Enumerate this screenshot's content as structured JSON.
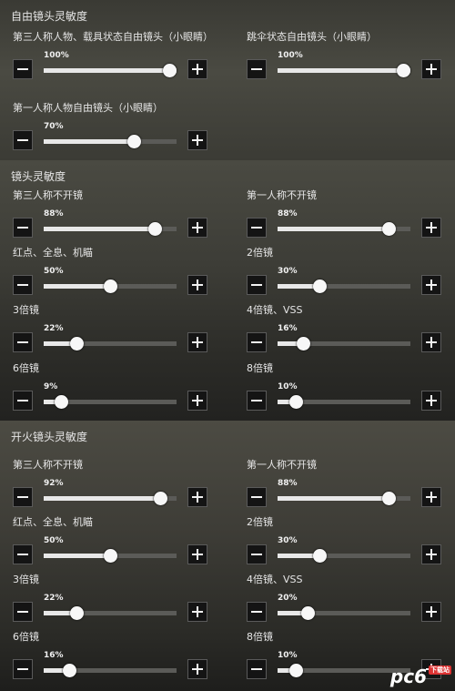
{
  "sections": [
    {
      "title": "自由镜头灵敏度",
      "rows": [
        [
          {
            "label": "第三人称人物、载具状态自由镜头（小眼睛）",
            "value": "100%",
            "level": 1.0
          },
          {
            "label": "跳伞状态自由镜头（小眼睛）",
            "value": "100%",
            "level": 1.0
          }
        ],
        [
          {
            "label": "第一人称人物自由镜头（小眼睛）",
            "value": "70%",
            "level": 0.7
          }
        ]
      ]
    },
    {
      "title": "镜头灵敏度",
      "rows": [
        [
          {
            "label": "第三人称不开镜",
            "value": "88%",
            "level": 0.88
          },
          {
            "label": "第一人称不开镜",
            "value": "88%",
            "level": 0.88
          }
        ],
        [
          {
            "label": "红点、全息、机瞄",
            "value": "50%",
            "level": 0.5
          },
          {
            "label": "2倍镜",
            "value": "30%",
            "level": 0.3
          }
        ],
        [
          {
            "label": "3倍镜",
            "value": "22%",
            "level": 0.22
          },
          {
            "label": "4倍镜、VSS",
            "value": "16%",
            "level": 0.16
          }
        ],
        [
          {
            "label": "6倍镜",
            "value": "9%",
            "level": 0.09
          },
          {
            "label": "8倍镜",
            "value": "10%",
            "level": 0.1
          }
        ]
      ]
    },
    {
      "title": "开火镜头灵敏度",
      "rows": [
        [
          {
            "label": "第三人称不开镜",
            "value": "92%",
            "level": 0.92
          },
          {
            "label": "第一人称不开镜",
            "value": "88%",
            "level": 0.88
          }
        ],
        [
          {
            "label": "红点、全息、机瞄",
            "value": "50%",
            "level": 0.5
          },
          {
            "label": "2倍镜",
            "value": "30%",
            "level": 0.3
          }
        ],
        [
          {
            "label": "3倍镜",
            "value": "22%",
            "level": 0.22
          },
          {
            "label": "4倍镜、VSS",
            "value": "20%",
            "level": 0.2
          }
        ],
        [
          {
            "label": "6倍镜",
            "value": "16%",
            "level": 0.16
          },
          {
            "label": "8倍镜",
            "value": "10%",
            "level": 0.1
          }
        ]
      ]
    }
  ],
  "watermark": {
    "brand": "pc6",
    "sub": "下载站"
  }
}
